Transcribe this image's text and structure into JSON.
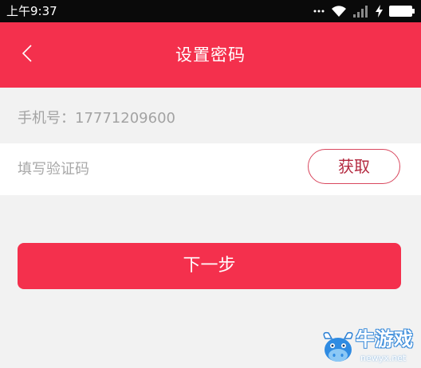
{
  "status_bar": {
    "time": "上午9:37",
    "icons": {
      "more": "more-dots-icon",
      "wifi": "wifi-icon",
      "signal": "signal-icon",
      "charging": "charging-bolt-icon",
      "battery": "battery-icon"
    }
  },
  "header": {
    "back_icon": "chevron-left-icon",
    "title": "设置密码"
  },
  "form": {
    "phone_label": "手机号：",
    "phone_number": "17771209600",
    "code_input": {
      "value": "",
      "placeholder": "填写验证码"
    },
    "get_code_button": "获取",
    "next_button": "下一步"
  },
  "watermark": {
    "logo_icon": "cow-logo-icon",
    "brand": "牛游戏",
    "site": "newyx.net"
  },
  "colors": {
    "status_bar": "#0A0A0A",
    "primary": "#F4304D",
    "background": "#F2F2F2",
    "row_background": "#FFFFFF",
    "muted_text": "#A3A3A3",
    "outline_button_border": "#D9475E",
    "outline_button_text": "#B42A40"
  }
}
